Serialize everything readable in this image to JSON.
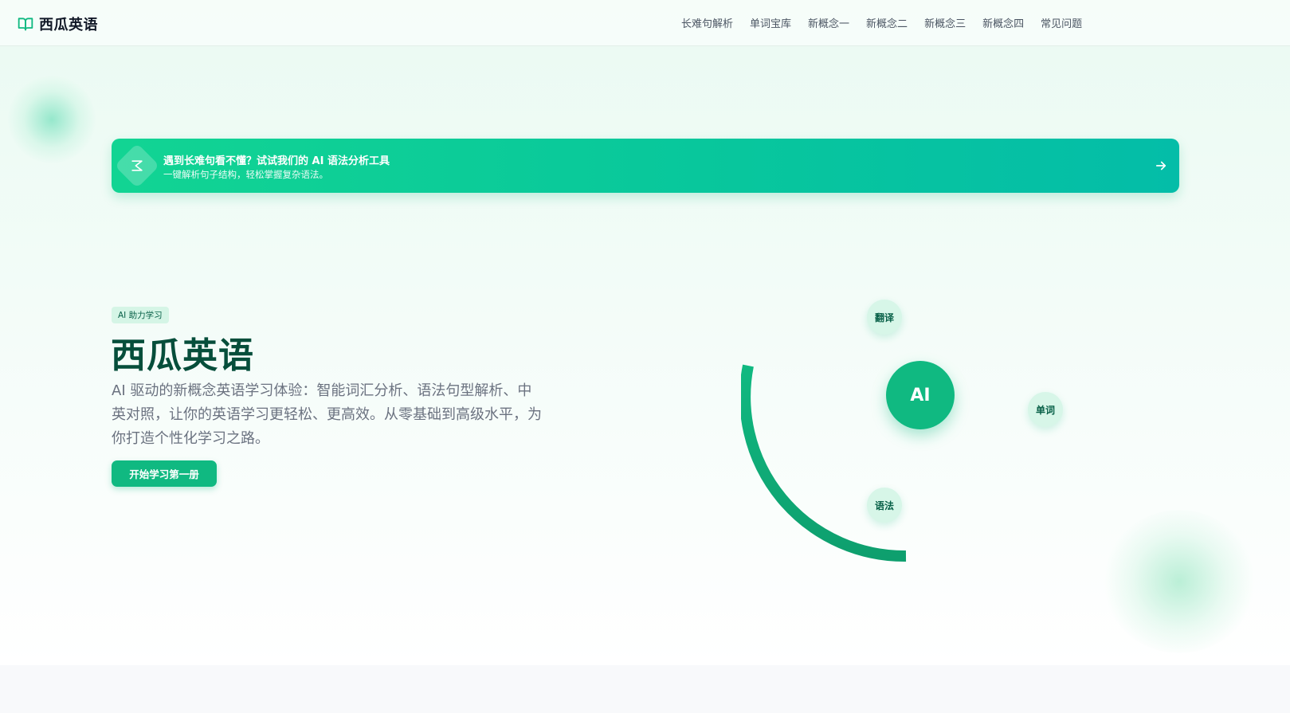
{
  "app": {
    "name": "西瓜英语"
  },
  "nav": {
    "items": [
      {
        "label": "长难句解析"
      },
      {
        "label": "单词宝库"
      },
      {
        "label": "新概念一"
      },
      {
        "label": "新概念二"
      },
      {
        "label": "新概念三"
      },
      {
        "label": "新概念四"
      },
      {
        "label": "常见问题"
      }
    ]
  },
  "banner": {
    "title": "遇到长难句看不懂？试试我们的 AI 语法分析工具",
    "subtitle": "一键解析句子结构，轻松掌握复杂语法。",
    "icon": "sparkle-icon",
    "arrow_icon": "arrow-right-icon"
  },
  "hero": {
    "tag": "AI 助力学习",
    "title": "西瓜英语",
    "description": "AI 驱动的新概念英语学习体验：智能词汇分析、语法句型解析、中英对照，让你的英语学习更轻松、更高效。从零基础到高级水平，为你打造个性化学习之路。",
    "cta_label": "开始学习第一册"
  },
  "graphic": {
    "core_label": "AI",
    "nodes": {
      "translate": "翻译",
      "word": "单词",
      "grammar": "语法"
    }
  },
  "colors": {
    "brand": "#10b981",
    "brand_dark": "#064e3b",
    "banner_start": "#12d493",
    "banner_end": "#04bda8",
    "node_bg": "#d7f6e8"
  }
}
